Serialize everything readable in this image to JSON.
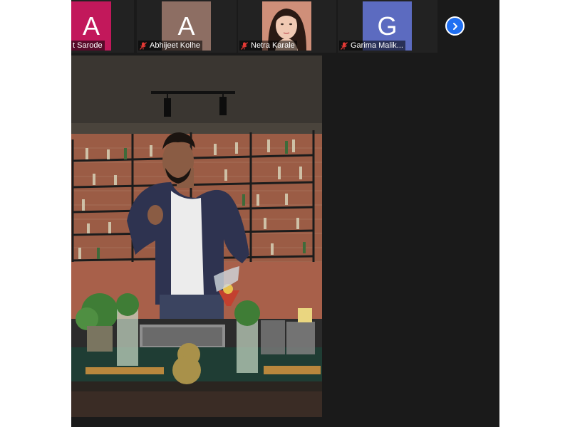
{
  "participants": [
    {
      "name": "t Sarode",
      "initial": "A",
      "color": "#c2185b",
      "muted": false
    },
    {
      "name": "Abhijeet Kolhe",
      "initial": "A",
      "color": "#8d6e63",
      "muted": true
    },
    {
      "name": "Netra Karale",
      "initial": "",
      "color": "#d9a48f",
      "muted": true,
      "photo": true
    },
    {
      "name": "Garima Malik...",
      "initial": "G",
      "color": "#5c6bc0",
      "muted": true
    }
  ],
  "controls": {
    "next_icon": "chevron-right-icon"
  },
  "colors": {
    "accent": "#1f6ff2",
    "muted_mic": "#e53935",
    "background": "#1a1a1a"
  }
}
